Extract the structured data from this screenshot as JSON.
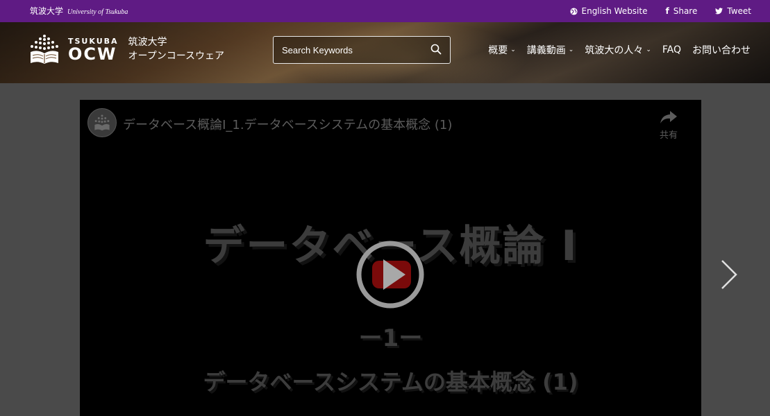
{
  "topbar": {
    "university_jp": "筑波大学",
    "university_en": "University of Tsukuba",
    "english_link": "English Website",
    "share_label": "Share",
    "tweet_label": "Tweet",
    "bg_color": "#5f1b84"
  },
  "header": {
    "logo_top": "TSUKUBA",
    "logo_main": "OCW",
    "logo_jp_line1": "筑波大学",
    "logo_jp_line2": "オープンコースウェア",
    "search_placeholder": "Search Keywords",
    "search_icon": "search-icon",
    "nav": [
      {
        "label": "概要",
        "has_dropdown": true
      },
      {
        "label": "講義動画",
        "has_dropdown": true
      },
      {
        "label": "筑波大の人々",
        "has_dropdown": true
      },
      {
        "label": "FAQ",
        "has_dropdown": false
      },
      {
        "label": "お問い合わせ",
        "has_dropdown": false
      }
    ]
  },
  "video": {
    "title": "データベース概論I_1.データベースシステムの基本概念 (1)",
    "share_label": "共有",
    "slide_title": "データベース概論 I",
    "slide_number": "ー1ー",
    "slide_subtitle": "データベースシステムの基本概念 (1)",
    "play_color": "#8b0000"
  },
  "carousel": {
    "next_icon": "chevron-right-icon"
  }
}
